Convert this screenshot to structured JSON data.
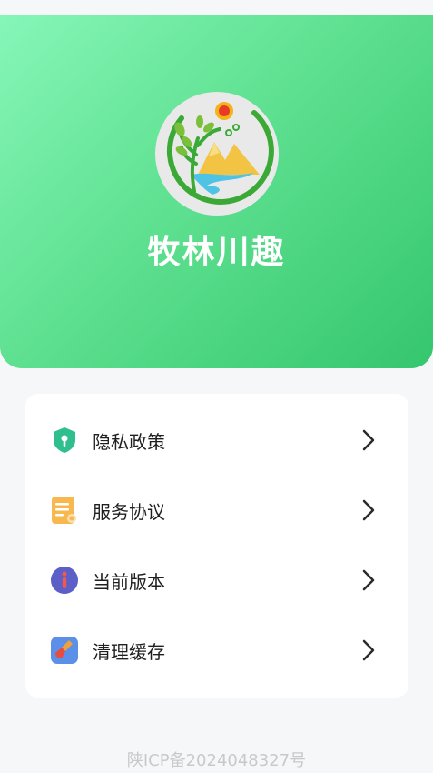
{
  "app": {
    "name": "牧林川趣"
  },
  "menu": {
    "items": [
      {
        "label": "隐私政策",
        "icon": "shield-lock-icon"
      },
      {
        "label": "服务协议",
        "icon": "document-icon"
      },
      {
        "label": "当前版本",
        "icon": "info-icon"
      },
      {
        "label": "清理缓存",
        "icon": "broom-icon"
      }
    ]
  },
  "footer": {
    "icp": "陕ICP备2024048327号"
  },
  "colors": {
    "brand_green": "#4fd987",
    "card_bg": "#ffffff",
    "page_bg": "#f6f7f9"
  }
}
